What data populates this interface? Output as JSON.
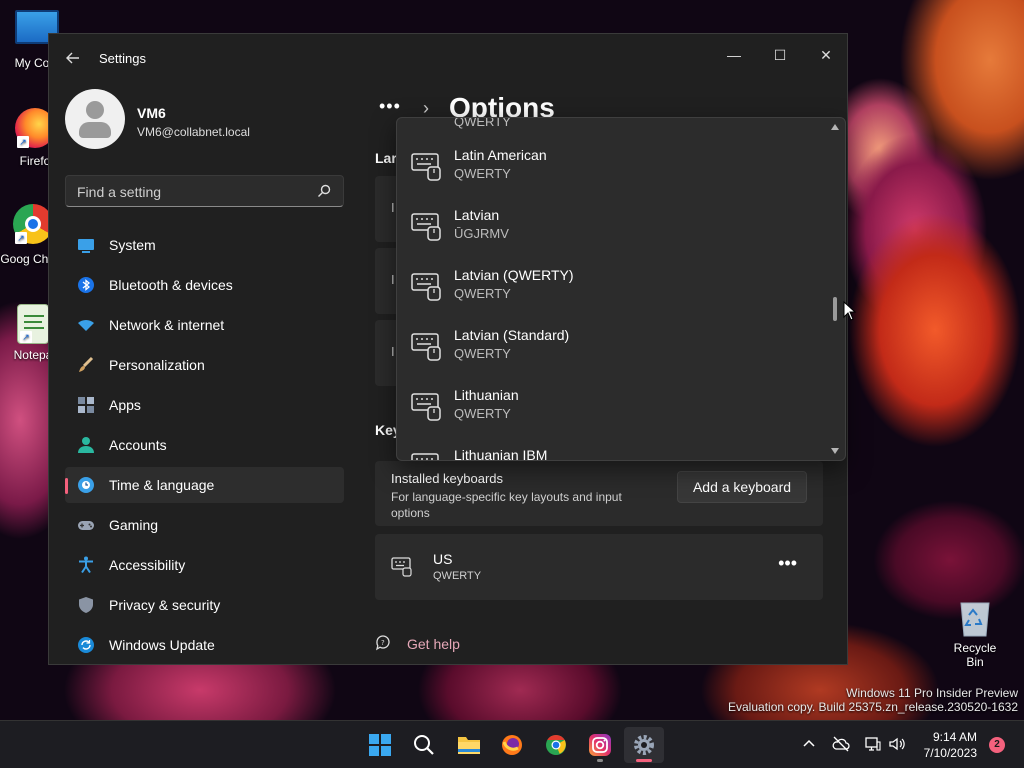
{
  "desktop": {
    "icons": [
      {
        "label": "My Com"
      },
      {
        "label": "Firefo"
      },
      {
        "label": "Goog Chron"
      },
      {
        "label": "Notepa"
      }
    ],
    "recycle_bin": "Recycle Bin",
    "watermark_line1": "Windows 11 Pro Insider Preview",
    "watermark_line2": "Evaluation copy. Build 25375.zn_release.230520-1632"
  },
  "window": {
    "title": "Settings",
    "controls": {
      "minimize": "—",
      "maximize": "☐",
      "close": "✕"
    }
  },
  "user": {
    "name": "VM6",
    "email": "VM6@collabnet.local"
  },
  "search": {
    "placeholder": "Find a setting"
  },
  "nav": {
    "items": [
      {
        "label": "System"
      },
      {
        "label": "Bluetooth & devices"
      },
      {
        "label": "Network & internet"
      },
      {
        "label": "Personalization"
      },
      {
        "label": "Apps"
      },
      {
        "label": "Accounts"
      },
      {
        "label": "Time & language"
      },
      {
        "label": "Gaming"
      },
      {
        "label": "Accessibility"
      },
      {
        "label": "Privacy & security"
      },
      {
        "label": "Windows Update"
      }
    ],
    "active_index": 6
  },
  "main": {
    "breadcrumb_more": "•••",
    "page_title": "Options",
    "section_language": "Lar",
    "section_keyboards": "Key",
    "row_partial_1": "I",
    "row_partial_2": "I",
    "row_partial_3": "I",
    "installed_keyboards": {
      "title": "Installed keyboards",
      "subtitle": "For language-specific key layouts and input options",
      "add_button": "Add a keyboard"
    },
    "keyboard_us": {
      "name": "US",
      "layout": "QWERTY",
      "more": "•••"
    },
    "get_help": "Get help"
  },
  "dropdown": {
    "items": [
      {
        "name": "",
        "layout": "QWERTY"
      },
      {
        "name": "Latin American",
        "layout": "QWERTY"
      },
      {
        "name": "Latvian",
        "layout": "ŪGJRMV"
      },
      {
        "name": "Latvian (QWERTY)",
        "layout": "QWERTY"
      },
      {
        "name": "Latvian (Standard)",
        "layout": "QWERTY"
      },
      {
        "name": "Lithuanian",
        "layout": "QWERTY"
      },
      {
        "name": "Lithuanian IBM",
        "layout": ""
      }
    ]
  },
  "taskbar": {
    "time": "9:14 AM",
    "date": "7/10/2023",
    "notification_count": "2"
  }
}
